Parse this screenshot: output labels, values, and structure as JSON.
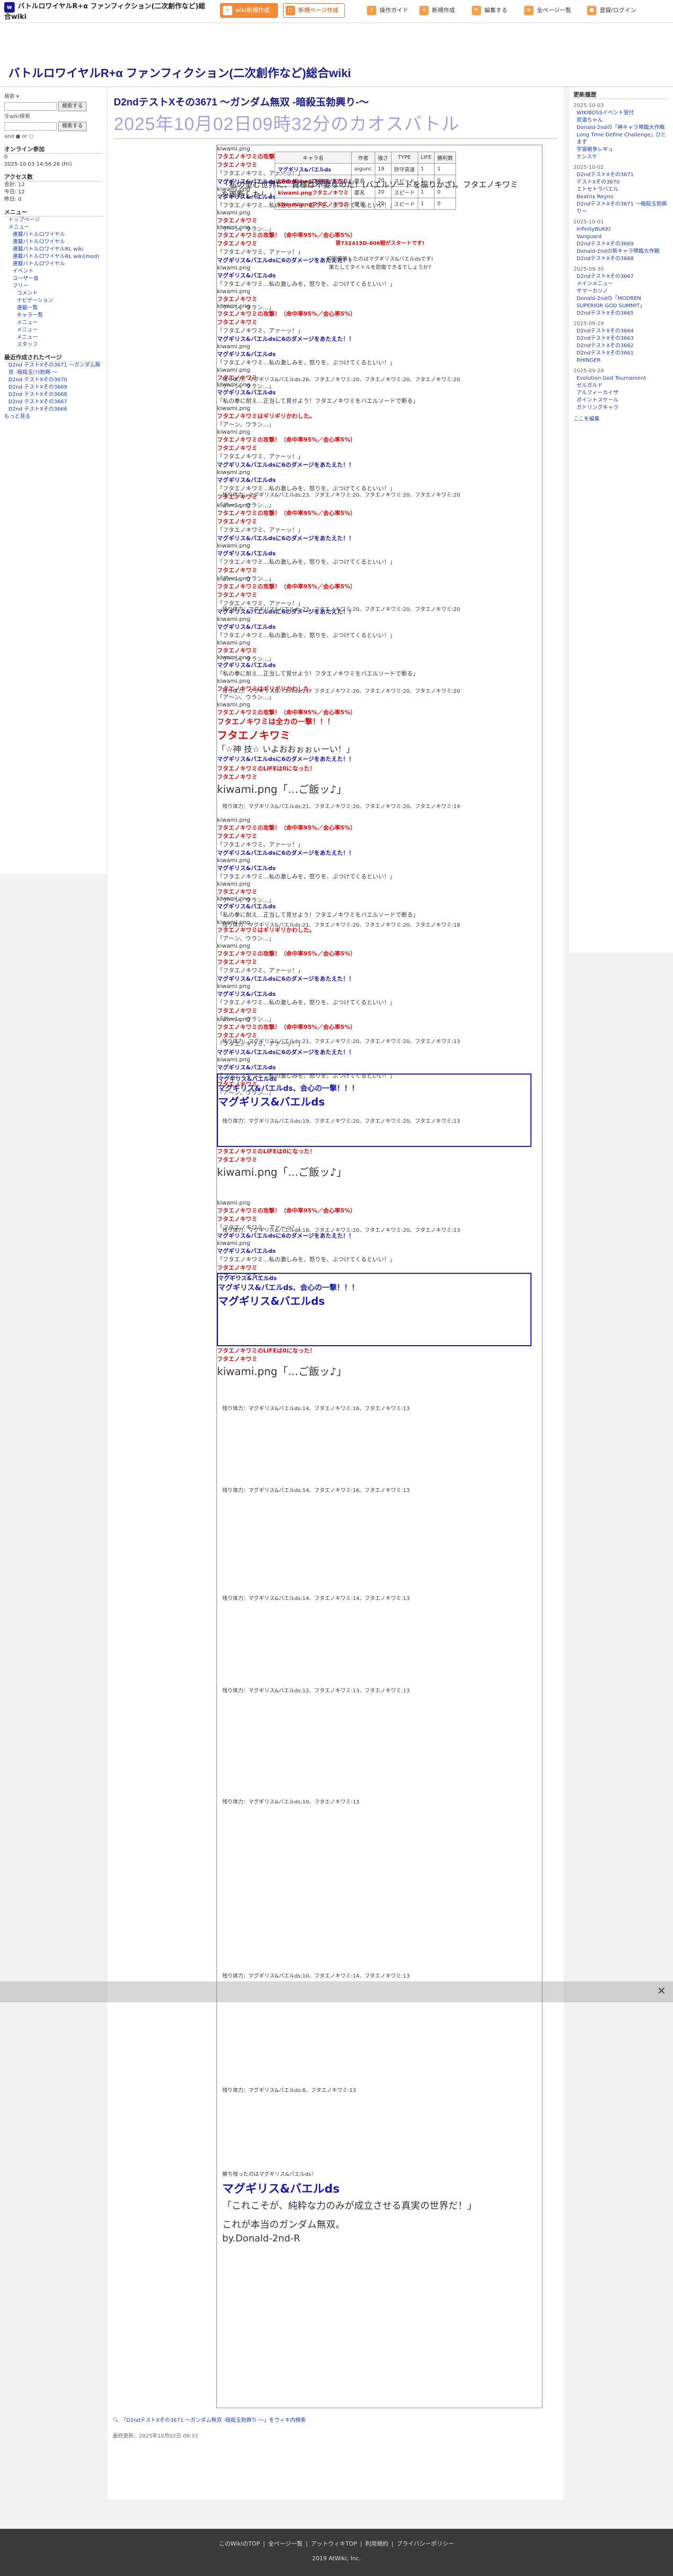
{
  "header": {
    "site_title": "バトルロワイヤルR+α ファンフィクション(二次創作など)総合wiki",
    "buttons": [
      "wiki新規作成",
      "新規ページ作成",
      "新規作成"
    ],
    "links": [
      "操作ガイド",
      "新規作成",
      "編集する",
      "全ページ一覧",
      "登録/ログイン"
    ]
  },
  "banner": {
    "wiki_title": "バトルロワイヤルR+α ファンフィクション(二次創作など)総合wiki"
  },
  "leftnav": {
    "search_label": "検索 ▾",
    "search_button": "検索する",
    "wiki_search_label": "全wiki検索",
    "wiki_search_button": "検索する",
    "and_or": "and ● or ○",
    "online_header": "オンライン参加",
    "online_count": "0",
    "date": "2025-10-03 14:56:28 (Fri)",
    "access_header": "アクセス数",
    "access_total": "合計: 12",
    "access_today": "今日: 12",
    "access_yesterday": "昨日: 0",
    "menu_header": "メニュー",
    "menu_items": [
      "トップページ",
      "メニュー",
      "連載バトルロワイヤル",
      "連載バトルロワイヤル",
      "連載バトルロワイヤルRL wiki",
      "連載バトルロワイヤルRL wiki(mod)",
      "連載バトルロワイヤル",
      "イベント",
      "ユーザー会",
      "フリー",
      "コメント",
      "ナビゲーション",
      "連載一覧",
      "キャラ一覧",
      "メニュー",
      "メニュー",
      "メニュー",
      "スタッフ"
    ],
    "recent_header": "最近作成されたページ",
    "recent_items": [
      "D2nd テストXその3671 〜ガンダム無双 -暗殺玉(?)勃興-〜",
      "D2nd テストXその3670",
      "D2nd テストXその3669",
      "D2nd テストXその3668",
      "D2nd テストXその3667",
      "D2nd テストXその3666"
    ],
    "more": "もっと見る"
  },
  "main": {
    "page_title": "D2ndテストXその3671 〜ガンダム無双 -暗殺玉勃興り-〜",
    "time_title": "2025年10月02日09時32分のカオスバトル",
    "table_headers": [
      "キャラ名",
      "作者",
      "強さ",
      "TYPE",
      "LIFE",
      "勝利数"
    ],
    "table_rows": [
      [
        "マグギリス&バエルds",
        "aigunc",
        "19",
        "防守高速",
        "1",
        "1"
      ],
      [
        "kiwami.pngフタエノキワミ",
        "匿名",
        "20",
        "スピード",
        "1",
        "0"
      ],
      [
        "kiwami.pngフタエノキワミ",
        "匿名",
        "20",
        "スピード",
        "1",
        "0"
      ],
      [
        "kiwami.pngフタエノキワミ",
        "匿名",
        "20",
        "スピード",
        "1",
        "0"
      ]
    ],
    "start_msg": "第732415D-806戦がスタートです!",
    "intro1": "初回優勝したのはマグギリス&バエルdsです!",
    "intro2": "果たしてタイトルを防衛できるでしょうか?",
    "img": "kiwami.png",
    "kiwami": "フタエノキワミ",
    "magu": "マグギリス&バエルds",
    "line_atk": "フタエノキワミの攻撃！（命中率95%／会心率5%）",
    "line_grab": "「フタエノキワミ、アァーッ！」",
    "line_dmg": "マグギリス&バエルdsに6のダメージをあたえた！！",
    "line_magu_atk": "マグギリス&バエルds",
    "line_magu_q": "「私の拳に耐え…正当して見せよう！フタエノキワミをバエルソードで断る」",
    "line_def": "「フタエノキワミ…私の激しみを、怒りを、ぶつけてくるといい！」",
    "line_crit": "フタエノキワミは全カの一撃！！！",
    "line_kick": "「☆神 技☆ いよおおぉぉぃーい！」",
    "line_avoid": "フタエノキワミはギリギリかわした。",
    "line_ukan": "「ア〜ン、ウラン…」",
    "line_hungry": "「…ご飯ッ♪」",
    "line_lose": "フタエノキワミのLIFEは0になった！",
    "line_big1": "マグギリス&バエルds、会心の一撃！！！",
    "line_big2": "マグギリス&バエルds",
    "line_big3": "「私の望む世界に、貴様は不要なのだ！(バエルソードを振りかざ)。フタエノキワミを両断した！」",
    "hp_prefix": "残り体力：",
    "hp_lines": [
      "残り体力：マグギリス&バエルds:26、フタエノキワミ:20、フタエノキワミ:20、フタエノキワミ:20",
      "残り体力：マグギリス&バエルds:23、フタエノキワミ:20、フタエノキワミ:20、フタエノキワミ:20",
      "残り体力：マグギリス&バエルds:21、フタエノキワミ:20、フタエノキワミ:20、フタエノキワミ:20",
      "残り体力：マグギリス&バエルds:21、フタエノキワミ:20、フタエノキワミ:20、フタエノキワミ:19",
      "残り体力：マグギリス&バエルds:21、フタエノキワミ:20、フタエノキワミ:20、フタエノキワミ:18",
      "残り体力：マグギリス&バエルds:21、フタエノキワミ:20、フタエノキワミ:20、フタエノキワミ:13",
      "残り体力：マグギリス&バエルds:19、フタエノキワミ:20、フタエノキワミ:20、フタエノキワミ:13",
      "残り体力：マグギリス&バエルds:18、フタエノキワミ:20、フタエノキワミ:20、フタエノキワミ:13",
      "残り体力：マグギリス&バエルds:14、フタエノキワミ:16、フタエノキワミ:13",
      "残り体力：マグギリス&バエルds:14、フタエノキワミ:16、フタエノキワミ:13",
      "残り体力：マグギリス&バエルds:14、フタエノキワミ:14、フタエノキワミ:13",
      "残り体力：マグギリス&バエルds:12、フタエノキワミ:13、フタエノキワミ:13",
      "残り体力：マグギリス&バエルds:10、フタエノキワミ:13",
      "残り体力：マグギリス&バエルds:10、フタエノキワミ:14、フタエノキワミ:13",
      "残り体力：マグギリス&バエルds:8、フタエノキワミ:13",
      "残り体力：マグギリス&バエルds:8、フタエノキワミ:15"
    ],
    "final1": "勝ち残ったのはマグギリス&バエルds！",
    "final2": "マグギリス&バエルds",
    "final3": "「これこそが、純粋な力のみが成立させる真実の世界だ！」",
    "final4": "これが本当のガンダム無双。",
    "final5": "by.Donald-2nd-R",
    "tweet": "「D2ndテストXその3671 〜ガンダム無双 -暗殺玉勃興り-〜」をウィキ内検索",
    "updated": "最終更新：2025年10月02日 09:33"
  },
  "rightnav": {
    "header": "更新履歴",
    "dates": [
      "2025-10-03",
      "2025-10-02",
      "2025-10-01",
      "2025-09-30",
      "2025-09-29",
      "2025-09-28"
    ],
    "items": [
      "WIKIBOSSイベント受付",
      "冥道ちゃん",
      "Donald-2ndの「神キャラ降臨大作戦 Long Time Define Challenge」ひとまず",
      "宇宙戦争レギュ",
      "ケンスケ",
      "D2ndテストXその3671",
      "テストXその3670",
      "エトセトラバエル",
      "Beatrix Reyno",
      "D2ndテストXその3671 〜暗殺玉勃興り〜",
      "InfinityBUKKI",
      "Vanguard",
      "D2ndテストXその3669",
      "Donald-2ndの新キャラ降臨大作戦",
      "D2ndテストXその3668",
      "D2ndテストXその3667",
      "メインメニュー",
      "サマーカジノ",
      "Donald-2ndの「MODREN SUPERIOR GOD SUMMIT」",
      "D2ndテストXその3665",
      "D2ndテストXその3664",
      "D2ndテストXその3663",
      "D2ndテストXその3662",
      "D2ndテストXその3661",
      "RHINGER",
      "Evolution God Tournament",
      "ゼルガルド",
      "アルフィーカイザ",
      "ポイントスケール",
      "ガトリングキャラ"
    ],
    "more": "ここを編集"
  },
  "footer": {
    "links": [
      "このWikiのTOP",
      "全ページ一覧",
      "アットウィキTOP",
      "利用規約",
      "プライバシーポリシー"
    ],
    "copyright": "2019 AtWiki, Inc."
  }
}
